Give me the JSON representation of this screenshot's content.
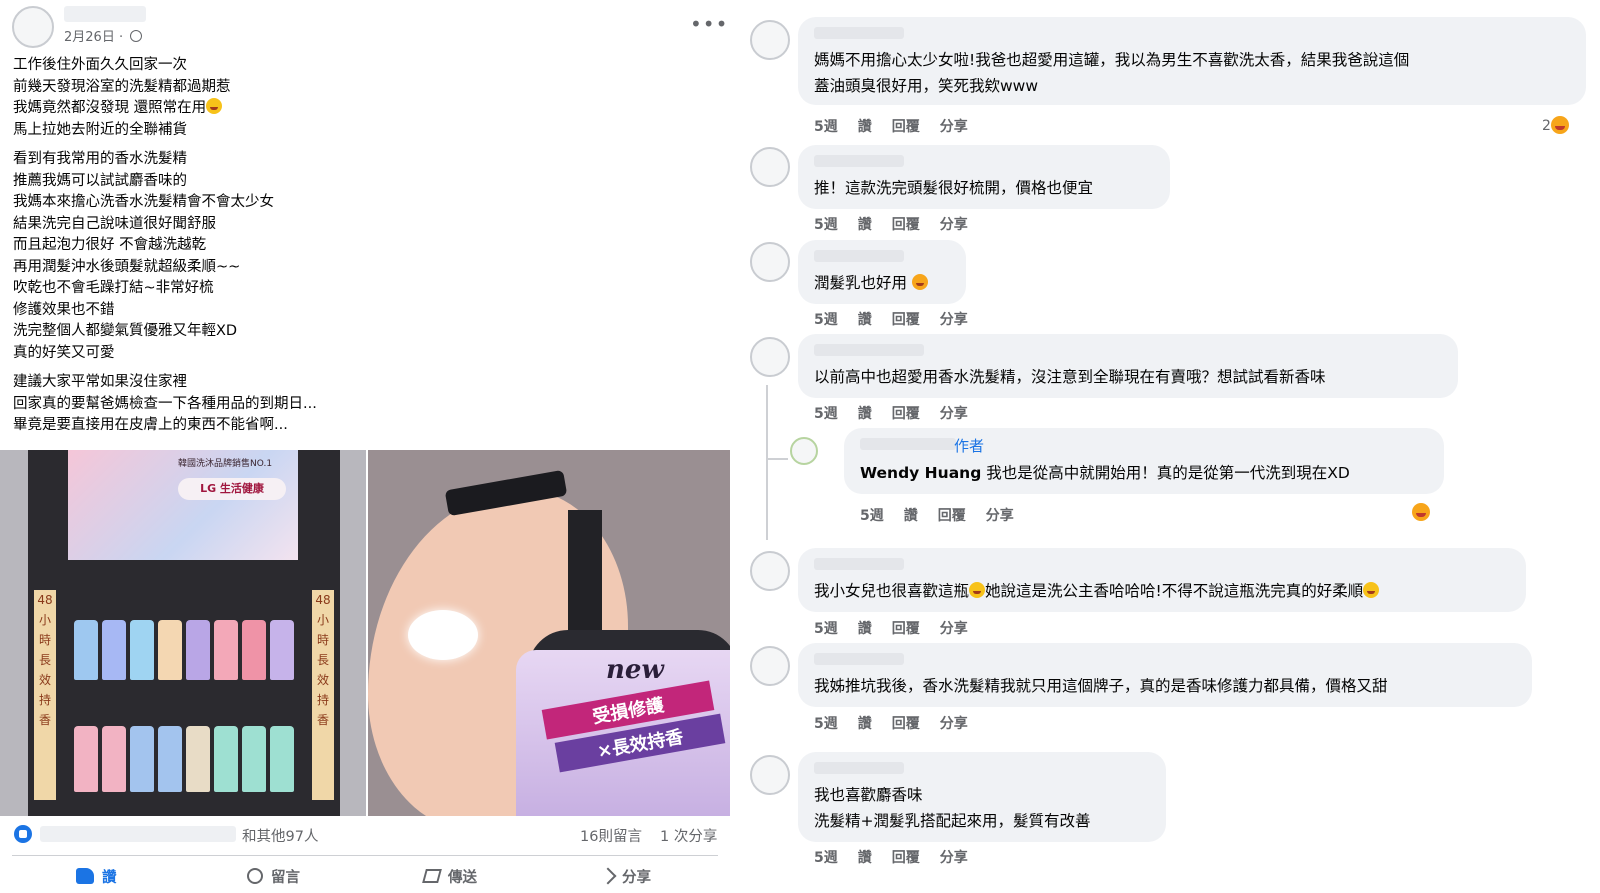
{
  "post": {
    "date": "2月26日",
    "paragraphs": [
      [
        "工作後住外面久久回家一次",
        "前幾天發現浴室的洗髮精都過期惹",
        "我媽竟然都沒發現 還照常在用",
        "馬上拉她去附近的全聯補貨"
      ],
      [
        "看到有我常用的香水洗髮精",
        "推薦我媽可以試試麝香味的",
        "我媽本來擔心洗香水洗髮精會不會太少女",
        "結果洗完自己說味道很好聞舒服",
        "而且起泡力很好 不會越洗越乾",
        "再用潤髮沖水後頭髮就超級柔順~~",
        "吹乾也不會毛躁打結~非常好梳",
        "修護效果也不錯",
        "洗完整個人都變氣質優雅又年輕XD",
        "真的好笑又可愛"
      ],
      [
        "建議大家平常如果沒住家裡",
        "回家真的要幫爸媽檢查一下各種用品的到期日...",
        "畢竟是要直接用在皮膚上的東西不能省啊..."
      ]
    ],
    "photo_left_text": {
      "banner_title": "韓國洗沐品牌銷售NO.1",
      "banner_logo": "LG 生活健康",
      "side_text": "48小時長效持香"
    },
    "photo_right_text": {
      "new": "new",
      "line1": "受損修護",
      "line2": "×長效持香"
    },
    "stats": {
      "others": "和其他97人",
      "comments": "16則留言",
      "shares": "1 次分享"
    },
    "actions": {
      "like": "讚",
      "comment": "留言",
      "send": "傳送",
      "share": "分享"
    }
  },
  "comment_meta": {
    "time": "5週",
    "like": "讚",
    "reply": "回覆",
    "share": "分享"
  },
  "comments": [
    {
      "lines": [
        "媽媽不用擔心太少女啦!我爸也超愛用這罐，我以為男生不喜歡洗太香，結果我爸說這個",
        "蓋油頭臭很好用，笑死我欸www"
      ],
      "reactions": "2"
    },
    {
      "lines": [
        "推！這款洗完頭髮很好梳開，價格也便宜"
      ]
    },
    {
      "lines": [
        "潤髮乳也好用"
      ]
    },
    {
      "lines": [
        "以前高中也超愛用香水洗髮精，沒注意到全聯現在有賣哦？想試試看新香味"
      ]
    },
    {
      "author_tag": "作者",
      "name": "Wendy Huang",
      "lines": [
        "我也是從高中就開始用！真的是從第一代洗到現在XD"
      ]
    },
    {
      "lines": [
        "我小女兒也很喜歡這瓶",
        "她說這是洗公主香哈哈哈!不得不說這瓶洗完真的好柔順"
      ]
    },
    {
      "lines": [
        "我姊推坑我後，香水洗髮精我就只用這個牌子，真的是香味修護力都具備，價格又甜"
      ]
    },
    {
      "lines": [
        "我也喜歡麝香味",
        "洗髮精+潤髮乳搭配起來用，髮質有改善"
      ]
    }
  ]
}
